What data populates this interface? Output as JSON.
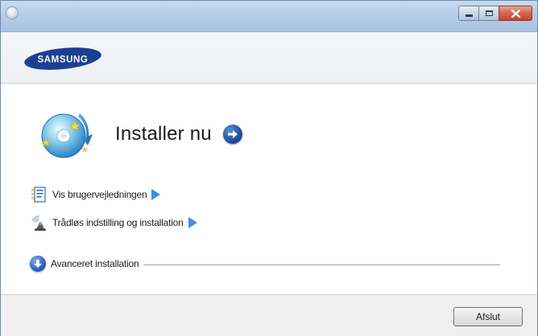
{
  "window": {
    "app_icon": "disc-app-icon",
    "controls": [
      "minimize-icon",
      "maximize-icon",
      "close-icon"
    ]
  },
  "brand": {
    "logo_text": "SAMSUNG",
    "logo_color": "#1c3f94"
  },
  "main": {
    "install_now_label": "Installer nu",
    "install_icon": "cd-install-icon",
    "go_icon": "arrow-right-circle-icon",
    "links": [
      {
        "label": "Vis brugervejledningen",
        "icon": "user-guide-icon"
      },
      {
        "label": "Trådløs indstilling og installation",
        "icon": "wireless-icon"
      }
    ],
    "advanced_label": "Avanceret installation",
    "advanced_icon": "arrow-down-circle-icon"
  },
  "footer": {
    "exit_label": "Afslut"
  },
  "colors": {
    "accent_arrow": "#3f8ce0",
    "titlebar": "#b6cde6",
    "close_button": "#c4442c"
  }
}
